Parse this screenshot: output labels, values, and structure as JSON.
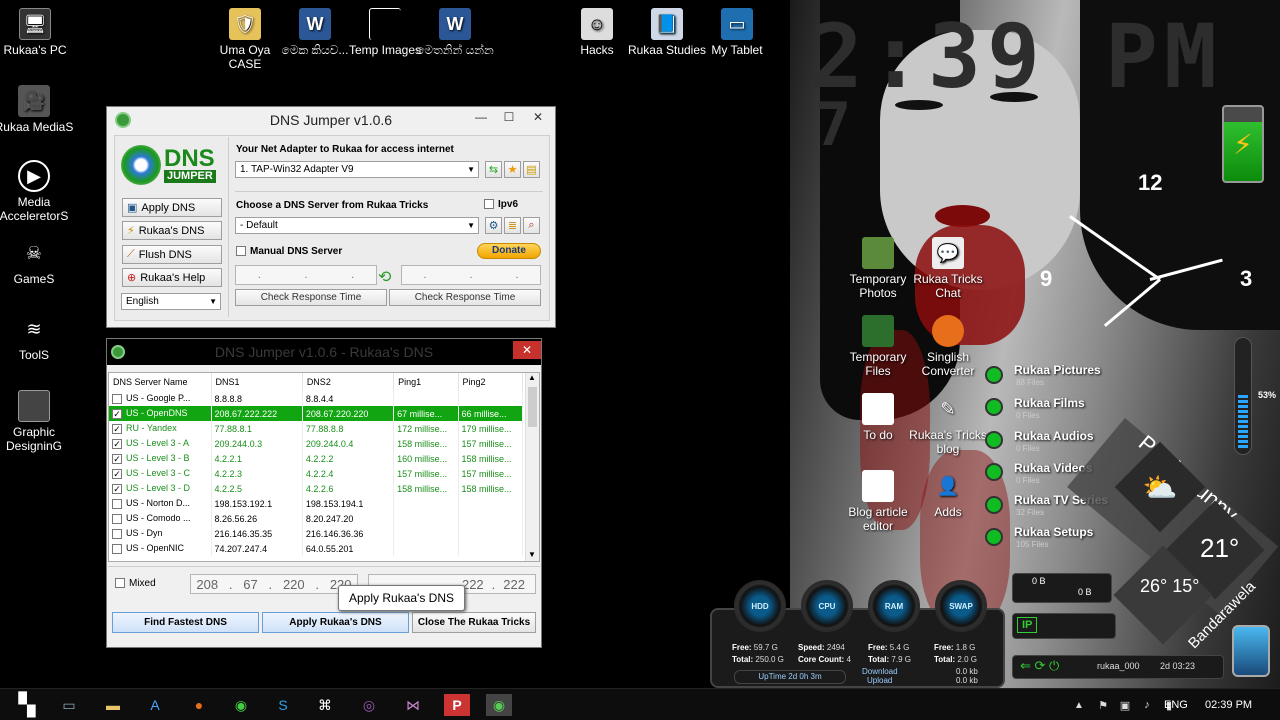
{
  "desktop": {
    "icons": [
      {
        "id": "rukaas-pc",
        "label": "Rukaa's PC"
      },
      {
        "id": "uma-oya",
        "label": "Uma Oya CASE"
      },
      {
        "id": "meka",
        "label": "මෙක කියව..."
      },
      {
        "id": "temp-images",
        "label": "Temp Images"
      },
      {
        "id": "methanin",
        "label": "මෙතනින් යන්න"
      },
      {
        "id": "hacks",
        "label": "Hacks"
      },
      {
        "id": "rukaa-studies",
        "label": "Rukaa Studies"
      },
      {
        "id": "my-tablet",
        "label": "My Tablet"
      },
      {
        "id": "media",
        "label": "Rukaa MediaS"
      },
      {
        "id": "accelerator",
        "label": "Media AcceleretorS"
      },
      {
        "id": "games",
        "label": "GameS"
      },
      {
        "id": "tools",
        "label": "ToolS"
      },
      {
        "id": "graphic",
        "label": "Graphic DesigninG"
      },
      {
        "id": "temp-photos",
        "label": "Temporary Photos"
      },
      {
        "id": "rukaa-chat",
        "label": "Rukaa Tricks Chat"
      },
      {
        "id": "temp-files",
        "label": "Temporary Files"
      },
      {
        "id": "singlish",
        "label": "Singlish Converter"
      },
      {
        "id": "todo",
        "label": "To do"
      },
      {
        "id": "tricks-blog",
        "label": "Rukaa's Tricks blog"
      },
      {
        "id": "blog-editor",
        "label": "Blog article editor"
      },
      {
        "id": "adds",
        "label": "Adds"
      }
    ]
  },
  "clock_widget": {
    "time": "2:39 PM",
    "small": "7",
    "dial_12": "12",
    "dial_9": "9",
    "dial_3": "3"
  },
  "weather": {
    "condition": "Partly sunny",
    "temp": "21°",
    "high_low": "26° 15°",
    "city": "Bandarawela"
  },
  "volume_pct": "53%",
  "library": [
    {
      "name": "Rukaa Pictures",
      "count": "88 Files"
    },
    {
      "name": "Rukaa Films",
      "count": "0 Files"
    },
    {
      "name": "Rukaa Audios",
      "count": "0 Files"
    },
    {
      "name": "Rukaa Videos",
      "count": "0 Files"
    },
    {
      "name": "Rukaa TV Series",
      "count": "32 Files"
    },
    {
      "name": "Rukaa Setups",
      "count": "105 Files"
    }
  ],
  "net": {
    "down": "0 B",
    "up": "0 B",
    "ip": "IP",
    "user": "rukaa_000",
    "uptime": "2d 03:23"
  },
  "sysmon": {
    "gauges": [
      "HDD",
      "CPU",
      "RAM",
      "SWAP"
    ],
    "free_label": "Free:",
    "total_label": "Total:",
    "hdd_free": "59.7 G",
    "hdd_total": "250.0 G",
    "speed_label": "Speed:",
    "speed": "2494",
    "cores_label": "Core Count:",
    "cores": "4",
    "ram_free": "5.4 G",
    "ram_total": "7.9 G",
    "swap_free": "1.8 G",
    "swap_total": "2.0 G",
    "uptime": "UpTime  2d 0h 3m",
    "download": "Download",
    "upload": "Upload",
    "dl_val": "0.0 kb",
    "ul_val": "0.0 kb"
  },
  "main_window": {
    "title": "DNS Jumper v1.0.6",
    "logo_text": "DNS",
    "logo_sub": "JUMPER",
    "adapter_label": "Your Net Adapter to Rukaa for access internet",
    "adapter_value": "1. TAP-Win32 Adapter V9",
    "choose_label": "Choose a DNS Server from Rukaa Tricks",
    "ipv6": "Ipv6",
    "dns_choice": "-   Default",
    "manual_label": "Manual DNS Server",
    "donate": "Donate",
    "check1": "Check Response Time",
    "check2": "Check Response Time",
    "buttons": {
      "apply": "Apply DNS",
      "rukaas": "Rukaa's DNS",
      "flush": "Flush DNS",
      "help": "Rukaa's Help"
    },
    "language": "English"
  },
  "list_window": {
    "title": "DNS Jumper v1.0.6 - Rukaa's DNS",
    "headers": [
      "DNS Server Name",
      "DNS1",
      "DNS2",
      "Ping1",
      "Ping2"
    ],
    "rows": [
      {
        "checked": false,
        "name": "US - Google P...",
        "dns1": "8.8.8.8",
        "dns2": "8.8.4.4",
        "p1": "",
        "p2": "",
        "style": ""
      },
      {
        "checked": true,
        "name": "US - OpenDNS",
        "dns1": "208.67.222.222",
        "dns2": "208.67.220.220",
        "p1": "67  millise...",
        "p2": "66  millise...",
        "style": "sel"
      },
      {
        "checked": true,
        "name": "RU - Yandex",
        "dns1": "77.88.8.1",
        "dns2": "77.88.8.8",
        "p1": "172 millise...",
        "p2": "179 millise...",
        "style": "grn"
      },
      {
        "checked": true,
        "name": "US - Level 3 - A",
        "dns1": "209.244.0.3",
        "dns2": "209.244.0.4",
        "p1": "158 millise...",
        "p2": "157 millise...",
        "style": "grn"
      },
      {
        "checked": true,
        "name": "US - Level 3 - B",
        "dns1": "4.2.2.1",
        "dns2": "4.2.2.2",
        "p1": "160 millise...",
        "p2": "158 millise...",
        "style": "grn"
      },
      {
        "checked": true,
        "name": "US - Level 3 - C",
        "dns1": "4.2.2.3",
        "dns2": "4.2.2.4",
        "p1": "157 millise...",
        "p2": "157 millise...",
        "style": "grn"
      },
      {
        "checked": true,
        "name": "US - Level 3 - D",
        "dns1": "4.2.2.5",
        "dns2": "4.2.2.6",
        "p1": "158 millise...",
        "p2": "158 millise...",
        "style": "grn"
      },
      {
        "checked": false,
        "name": "US - Norton D...",
        "dns1": "198.153.192.1",
        "dns2": "198.153.194.1",
        "p1": "",
        "p2": "",
        "style": ""
      },
      {
        "checked": false,
        "name": "US - Comodo ...",
        "dns1": "8.26.56.26",
        "dns2": "8.20.247.20",
        "p1": "",
        "p2": "",
        "style": ""
      },
      {
        "checked": false,
        "name": "US - Dyn",
        "dns1": "216.146.35.35",
        "dns2": "216.146.36.36",
        "p1": "",
        "p2": "",
        "style": ""
      },
      {
        "checked": false,
        "name": "US - OpenNIC",
        "dns1": "74.207.247.4",
        "dns2": "64.0.55.201",
        "p1": "",
        "p2": "",
        "style": ""
      }
    ],
    "mixed": "Mixed",
    "ip1": [
      "208",
      "67",
      "220",
      "220"
    ],
    "ip2": [
      "222"
    ],
    "find_fastest": "Find Fastest DNS",
    "apply_rukaas": "Apply Rukaa's DNS",
    "close": "Close The Rukaa Tricks"
  },
  "tooltip": "Apply Rukaa's DNS",
  "taskbar": {
    "lang": "ENG",
    "time": "02:39 PM"
  }
}
